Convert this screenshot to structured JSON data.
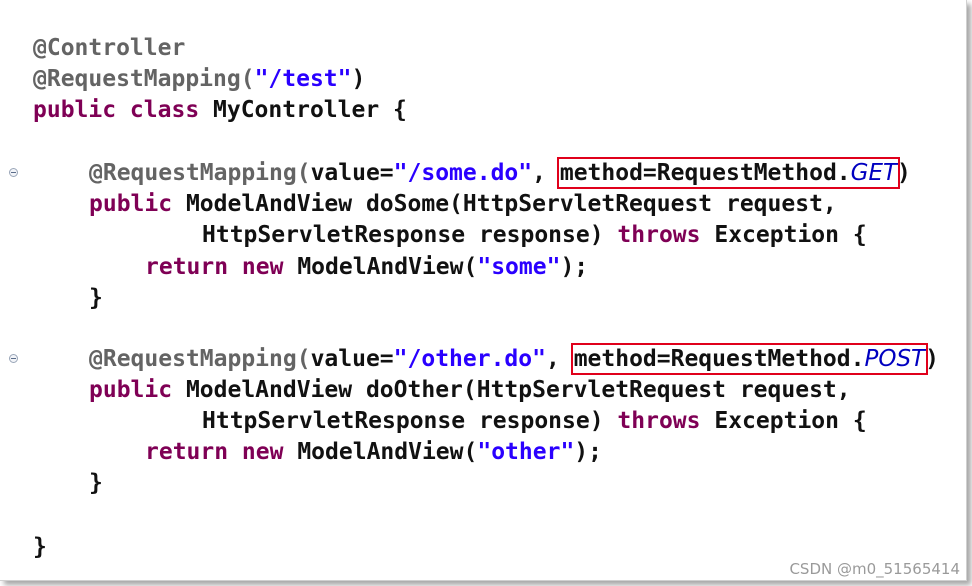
{
  "code": {
    "l1_annotation": "@Controller",
    "l2_annotation": "@RequestMapping(",
    "l2_string": "\"/test\"",
    "l2_close": ")",
    "l3_kw": "public class",
    "l3_name": " MyController {",
    "m1": {
      "annotation": "@RequestMapping(",
      "value_key": "value=",
      "value_str": "\"/some.do\"",
      "comma": ", ",
      "method_text": "method=RequestMethod.",
      "method_enum": "GET",
      "close": ")",
      "sig_kw": "public",
      "sig_rest": " ModelAndView doSome(HttpServletRequest request,",
      "sig2_plain": "HttpServletResponse response) ",
      "sig2_kw": "throws",
      "sig2_rest": " Exception {",
      "ret_kw": "return new",
      "ret_mid": " ModelAndView(",
      "ret_str": "\"some\"",
      "ret_end": ");",
      "end": "}"
    },
    "m2": {
      "annotation": "@RequestMapping(",
      "value_key": "value=",
      "value_str": "\"/other.do\"",
      "comma": ", ",
      "method_text": "method=RequestMethod.",
      "method_enum": "POST",
      "close": ")",
      "sig_kw": "public",
      "sig_rest": " ModelAndView doOther(HttpServletRequest request,",
      "sig2_plain": "HttpServletResponse response) ",
      "sig2_kw": "throws",
      "sig2_rest": " Exception {",
      "ret_kw": "return new",
      "ret_mid": " ModelAndView(",
      "ret_str": "\"other\"",
      "ret_end": ");",
      "end": "}"
    },
    "class_end": "}"
  },
  "watermark": "CSDN @m0_51565414",
  "colors": {
    "annotation": "#646464",
    "keyword": "#7f0055",
    "string": "#2a00ff",
    "enum_constant": "#0000c0",
    "highlight_box": "#e0001b"
  },
  "icons": [
    "fold-collapse-icon",
    "fold-collapse-icon"
  ]
}
